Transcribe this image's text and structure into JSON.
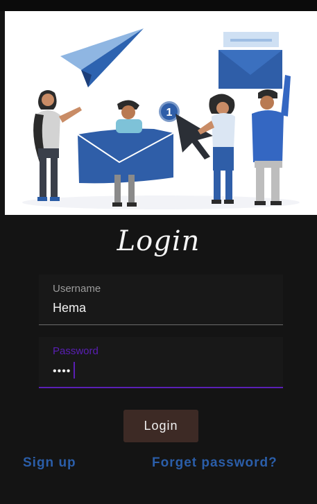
{
  "login": {
    "title": "Login",
    "username_label": "Username",
    "username_value": "Hema",
    "password_label": "Password",
    "password_value": "••••",
    "login_button": "Login",
    "signup_link": "Sign up",
    "forget_link": "Forget password?"
  },
  "illustration": {
    "notification_count": "1"
  }
}
